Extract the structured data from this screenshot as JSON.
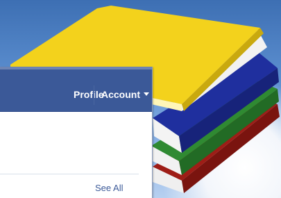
{
  "nav": {
    "profile_label": "Profile",
    "account_label": "Account"
  },
  "notifications": {
    "see_all_label": "See All"
  },
  "colors": {
    "brand_bar": "#3b5998",
    "link": "#3b5998",
    "background_sky": "#5c8fd0",
    "book_yellow": "#f3d21c",
    "book_blue": "#1f2f9e",
    "book_green": "#2f8a32",
    "book_red": "#9e1d16"
  },
  "icons": [
    "account-caret-icon",
    "books-illustration"
  ]
}
